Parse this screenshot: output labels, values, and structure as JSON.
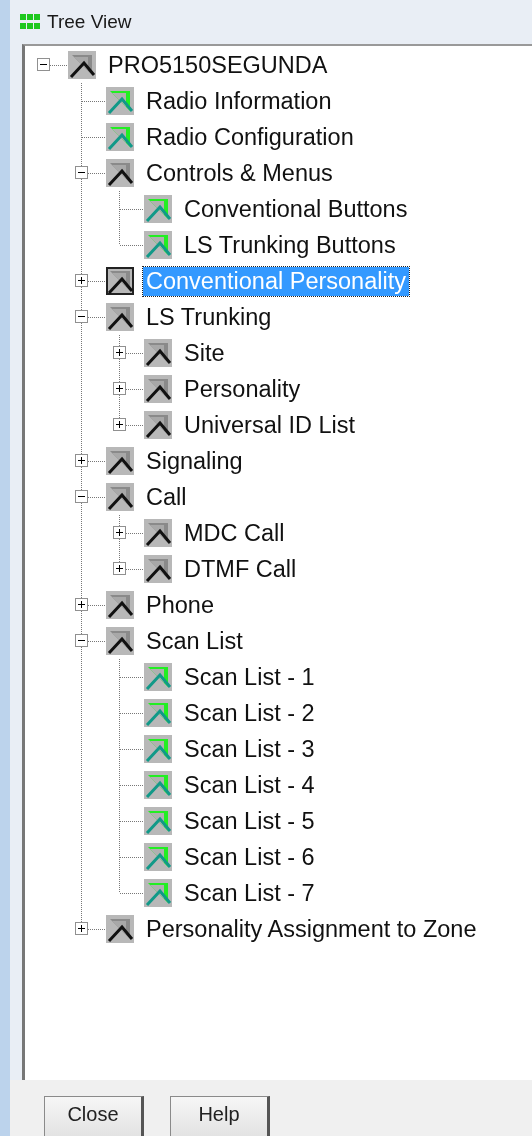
{
  "window": {
    "title": "Tree View"
  },
  "tree": [
    {
      "label": "PRO5150SEGUNDA",
      "kind": "branch",
      "selected": false,
      "expanded": true,
      "children": [
        {
          "label": "Radio Information",
          "kind": "leaf",
          "selected": false
        },
        {
          "label": "Radio Configuration",
          "kind": "leaf",
          "selected": false
        },
        {
          "label": "Controls & Menus",
          "kind": "branch",
          "selected": false,
          "expanded": true,
          "children": [
            {
              "label": "Conventional Buttons",
              "kind": "leaf",
              "selected": false
            },
            {
              "label": "LS Trunking Buttons",
              "kind": "leaf",
              "selected": false
            }
          ]
        },
        {
          "label": "Conventional Personality",
          "kind": "branch",
          "selected": true,
          "expanded": false
        },
        {
          "label": "LS Trunking",
          "kind": "branch",
          "selected": false,
          "expanded": true,
          "children": [
            {
              "label": "Site",
              "kind": "branch",
              "selected": false,
              "expanded": false
            },
            {
              "label": "Personality",
              "kind": "branch",
              "selected": false,
              "expanded": false
            },
            {
              "label": "Universal ID List",
              "kind": "branch",
              "selected": false,
              "expanded": false
            }
          ]
        },
        {
          "label": "Signaling",
          "kind": "branch",
          "selected": false,
          "expanded": false
        },
        {
          "label": "Call",
          "kind": "branch",
          "selected": false,
          "expanded": true,
          "children": [
            {
              "label": "MDC Call",
              "kind": "branch",
              "selected": false,
              "expanded": false
            },
            {
              "label": "DTMF Call",
              "kind": "branch",
              "selected": false,
              "expanded": false
            }
          ]
        },
        {
          "label": "Phone",
          "kind": "branch",
          "selected": false,
          "expanded": false
        },
        {
          "label": "Scan List",
          "kind": "branch",
          "selected": false,
          "expanded": true,
          "children": [
            {
              "label": "Scan List - 1",
              "kind": "leaf",
              "selected": false
            },
            {
              "label": "Scan List - 2",
              "kind": "leaf",
              "selected": false
            },
            {
              "label": "Scan List - 3",
              "kind": "leaf",
              "selected": false
            },
            {
              "label": "Scan List - 4",
              "kind": "leaf",
              "selected": false
            },
            {
              "label": "Scan List - 5",
              "kind": "leaf",
              "selected": false
            },
            {
              "label": "Scan List - 6",
              "kind": "leaf",
              "selected": false
            },
            {
              "label": "Scan List - 7",
              "kind": "leaf",
              "selected": false
            }
          ]
        },
        {
          "label": "Personality Assignment to Zone",
          "kind": "branch",
          "selected": false,
          "expanded": false
        }
      ]
    }
  ],
  "buttons": [
    "Close",
    "Help"
  ]
}
